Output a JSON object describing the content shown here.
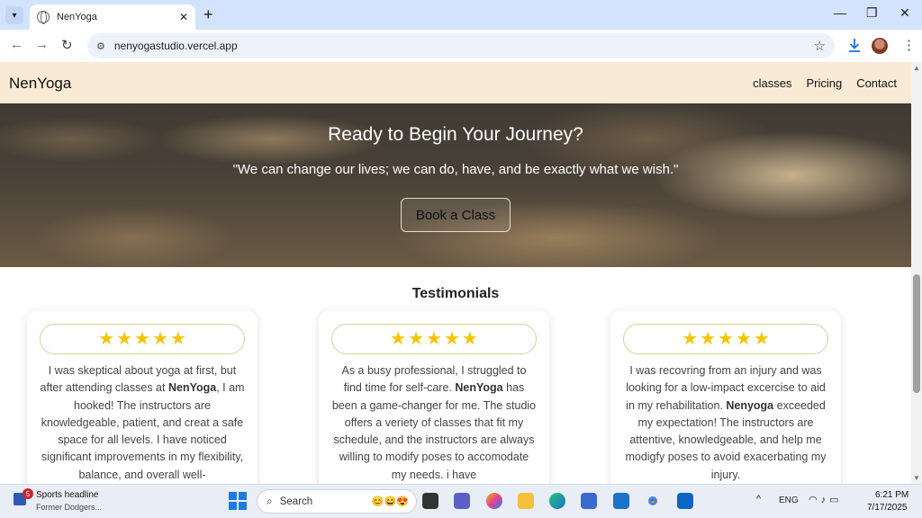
{
  "browser": {
    "tab_title": "NenYoga",
    "tab_close": "✕",
    "new_tab": "+",
    "url": "nenyogastudio.vercel.app",
    "window_controls": [
      "—",
      "❐",
      "✕"
    ]
  },
  "site": {
    "logo": "NenYoga",
    "nav": [
      "classes",
      "Pricing",
      "Contact"
    ]
  },
  "hero": {
    "title": "Ready to Begin Your Journey?",
    "quote": "\"We can change our lives; we can do, have, and be exactly what we wish.\"",
    "button": "Book a Class"
  },
  "testimonials": {
    "heading": "Testimonials",
    "cards": [
      {
        "rating": 5,
        "before": "I was skeptical about yoga at first, but after attending classes at ",
        "brand": "NenYoga",
        "after": ", I am hooked! The instructors are knowledgeable, patient, and creat a safe space for all levels. I have noticed significant improvements in my flexibility, balance, and overall well-"
      },
      {
        "rating": 5,
        "before": "As a busy professional, I struggled to find time for self-care. ",
        "brand": "NenYoga",
        "after": " has been a game-changer for me. The studio offers a veriety of classes that fit my schedule, and the instructors are always willing to modify poses to accomodate my needs. i have"
      },
      {
        "rating": 5,
        "before": "I was recovring from an injury and was looking for a low-impact excercise to aid in my rehabilitation. ",
        "brand": "Nenyoga",
        "after": " exceeded my expectation! The instructors are attentive, knowledgeable, and help me modigfy poses to avoid exacerbating my injury."
      }
    ]
  },
  "taskbar": {
    "news_badge": "5",
    "news_title": "Sports headline",
    "news_sub": "Former Dodgers...",
    "search_placeholder": "Search",
    "lang": "ENG",
    "time": "6:21 PM",
    "date": "7/17/2025"
  },
  "colors": {
    "nav_bg": "#f9ead5",
    "star": "#f5c400",
    "pill_border": "#d9cf9b"
  }
}
